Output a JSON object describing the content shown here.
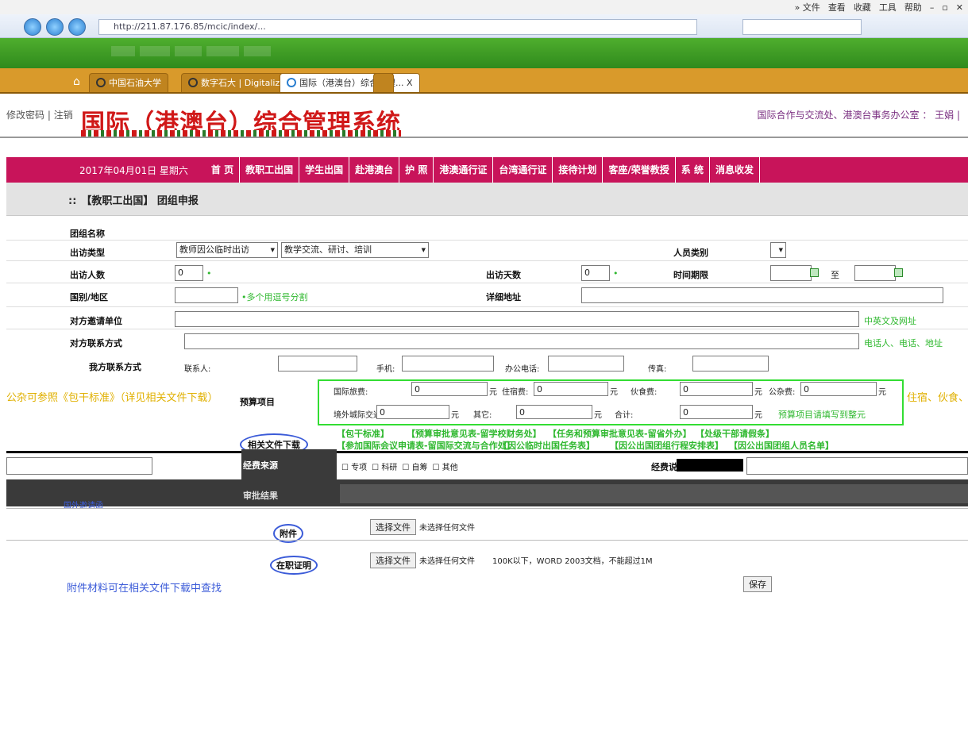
{
  "browser": {
    "menu": [
      "» 文件",
      "查看",
      "收藏",
      "工具",
      "帮助"
    ],
    "address": "http://211.87.176.85/mcic/index/...",
    "tabs": [
      {
        "label": "中国石油大学"
      },
      {
        "label": "数字石大 | Digitalized ..."
      },
      {
        "label": "国际（港澳台）综合管理..."
      }
    ],
    "close_tab": "X"
  },
  "header": {
    "left_links": [
      "修改密码",
      "注销"
    ],
    "title": "国际（港澳台）综合管理系统",
    "right_text": "国际合作与交流处、港澳台事务办公室 ： 王娟 |"
  },
  "menu": {
    "date": "2017年04月01日 星期六",
    "items": [
      "首 页",
      "教职工出国",
      "学生出国",
      "赴港澳台",
      "护 照",
      "港澳通行证",
      "台湾通行证",
      "接待计划",
      "客座/荣誉教授",
      "系 统",
      "消息收发"
    ]
  },
  "crumb": {
    "dots": "::",
    "text": "【教职工出国】 团组申报"
  },
  "form": {
    "group_name_label": "团组名称",
    "visit_type_label": "出访类型",
    "visit_type_value": "教师因公临时出访",
    "visit_purpose_value": "教学交流、研讨、培训",
    "staff_type_label": "人员类别",
    "count_label": "出访人数",
    "count_value": "0",
    "days_label": "出访天数",
    "days_value": "0",
    "period_label": "时间期限",
    "period_to": "至",
    "country_label": "国别/地区",
    "country_note": "•多个用逗号分割",
    "address_label": "详细地址",
    "inviter_label": "对方邀请单位",
    "inviter_note": "中英文及网址",
    "contact_label": "对方联系方式",
    "contact_note": "电话人、电话、地址",
    "our_contact_label": "我方联系方式",
    "contact_person": "联系人:",
    "mobile": "手机:",
    "office_phone": "办公电话:",
    "fax": "传真:",
    "budget_label": "预算项目",
    "budget": {
      "intl_travel": "国际旅费:",
      "lodging": "住宿费:",
      "meals": "伙食费:",
      "misc": "公杂费:",
      "city_transport": "境外城际交通:",
      "other": "其它:",
      "total": "合计:",
      "unit": "元",
      "value": "0",
      "budget_note": "预算项目请填写到整元"
    },
    "docs_label": "相关文件下载",
    "doc_links": [
      "【包干标准】",
      "【预算审批意见表-留学校财务处】",
      "【任务和预算审批意见表-留省外办】",
      "【处级干部请假条】",
      "【参加国际会议申请表-留国际交流与合作处】",
      "【因公临时出国任务表】",
      "【因公出国团组行程安排表】",
      "【因公出国团组人员名单】"
    ],
    "left_orange": "公杂可参照《包干标准》（详见相关文件下载）",
    "right_orange": "住宿、伙食、",
    "funding_label": "经费来源",
    "funding_options": [
      "专项",
      "科研",
      "自筹",
      "其他"
    ],
    "funding_desc_label": "经费说明",
    "approval_label": "审批结果",
    "left_note": "国外邀请函",
    "attach_label": "附件",
    "other_label": "在职证明",
    "choose_file": "选择文件",
    "no_file": "未选择任何文件",
    "file_hint": "100K以下，WORD 2003文档，不能超过1M",
    "bottom_note": "附件材料可在相关文件下载中查找",
    "save": "保存"
  }
}
